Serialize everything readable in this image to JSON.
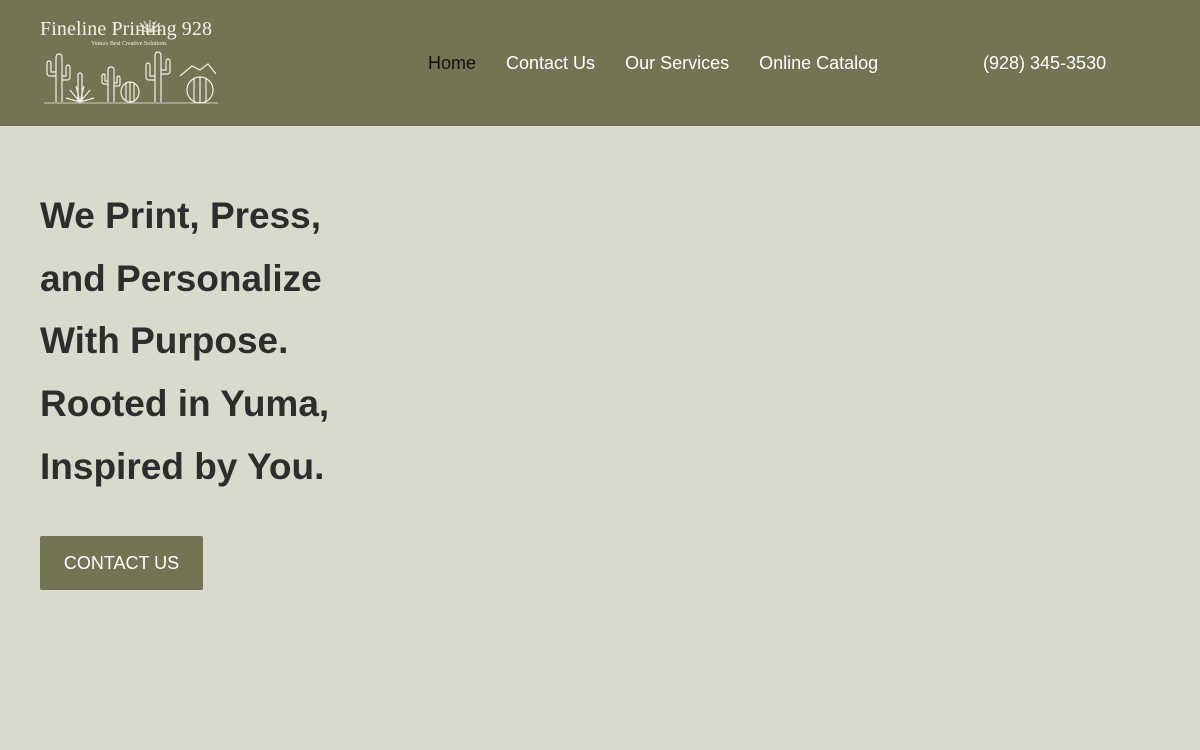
{
  "brand": {
    "name": "Fineline Printing 928",
    "tagline": "Yuma's Best Creative Solutions",
    "logo_icon": "desert-cactus-logo"
  },
  "nav": {
    "items": [
      {
        "label": "Home",
        "active": true
      },
      {
        "label": "Contact Us",
        "active": false
      },
      {
        "label": "Our Services",
        "active": false
      },
      {
        "label": "Online Catalog",
        "active": false
      }
    ],
    "phone": "(928) 345-3530"
  },
  "hero": {
    "lines": [
      "We Print, Press,",
      "and Personalize",
      "With Purpose.",
      "Rooted in Yuma,",
      "Inspired by You."
    ],
    "cta_label": "CONTACT US"
  },
  "colors": {
    "header_bg": "#727453",
    "page_bg": "#d9d9cc",
    "heading_text": "#2d2d2d",
    "button_bg": "#727453"
  }
}
